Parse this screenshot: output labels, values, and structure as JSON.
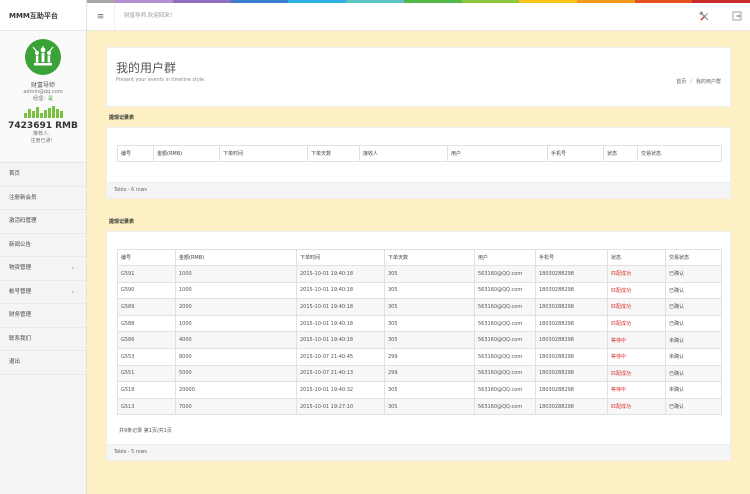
{
  "colors": {
    "rainbow": [
      "#c6c6c6",
      "#a8a8a8",
      "#b48fcf",
      "#8e6fc2",
      "#3d7fcf",
      "#2fb0e4",
      "#5cc3c0",
      "#52b847",
      "#8dc63f",
      "#f8c419",
      "#f39a1e",
      "#e5511e",
      "#c92c2c"
    ],
    "accent_green": "#3aa237",
    "status_red": "#d9302c"
  },
  "sidebar": {
    "brand": "MMM互助平台",
    "profile": {
      "name": "财富导师",
      "email": "admin@qq.com",
      "role_label": "经理：",
      "role_value": "是",
      "balance": "7423691 RMB",
      "referrer_label": "推荐人：",
      "reg_label": "注册已通！",
      "activity": [
        5,
        8,
        6,
        10,
        5,
        7,
        9,
        11,
        8,
        6
      ]
    },
    "menu": [
      {
        "label": "首页",
        "arrow": ""
      },
      {
        "label": "注册新会员",
        "arrow": ""
      },
      {
        "label": "激活码管理",
        "arrow": ""
      },
      {
        "label": "新闻公告",
        "arrow": ""
      },
      {
        "label": "物资管理",
        "arrow": "‹"
      },
      {
        "label": "帐号管理",
        "arrow": "‹"
      },
      {
        "label": "财务管理",
        "arrow": ""
      },
      {
        "label": "联系我们",
        "arrow": ""
      },
      {
        "label": "退出",
        "arrow": ""
      }
    ]
  },
  "topbar": {
    "toggle_icon": "≡",
    "welcome": "财富导师,欢迎回来！"
  },
  "header": {
    "title": "我的用户群",
    "subtitle": "Present your events in timeline style.",
    "breadcrumb_home": "首页",
    "breadcrumb_sep": "/",
    "breadcrumb_current": "我的用户群"
  },
  "section1": {
    "title": "提现记录表",
    "columns": [
      "编号",
      "金额(RMB)",
      "下单时间",
      "下单天数",
      "接收人",
      "用户",
      "手机号",
      "状态",
      "交易状态"
    ],
    "footer": "Table - 6 rows"
  },
  "section2": {
    "title": "提现记录表",
    "columns": [
      "编号",
      "金额(RMB)",
      "下单时间",
      "下单天数",
      "用户",
      "手机号",
      "状态",
      "交易状态"
    ],
    "rows": [
      {
        "id": "G591",
        "amount": "1000",
        "time": "2015-10-01 19:40:18",
        "days": "305",
        "user": "563160@QQ.com",
        "phone": "18030288298",
        "status": "匹配成功",
        "status_red": true,
        "trade": "已确认"
      },
      {
        "id": "G590",
        "amount": "1000",
        "time": "2015-10-01 19:40:18",
        "days": "305",
        "user": "563160@QQ.com",
        "phone": "18030288298",
        "status": "匹配成功",
        "status_red": true,
        "trade": "已确认"
      },
      {
        "id": "G589",
        "amount": "2000",
        "time": "2015-10-01 19:40:18",
        "days": "305",
        "user": "563160@QQ.com",
        "phone": "18030288298",
        "status": "匹配成功",
        "status_red": true,
        "trade": "已确认"
      },
      {
        "id": "G588",
        "amount": "1000",
        "time": "2015-10-01 19:40:18",
        "days": "305",
        "user": "563160@QQ.com",
        "phone": "18030288298",
        "status": "匹配成功",
        "status_red": true,
        "trade": "已确认"
      },
      {
        "id": "G586",
        "amount": "4000",
        "time": "2015-10-01 19:40:18",
        "days": "305",
        "user": "563160@QQ.com",
        "phone": "18030288298",
        "status": "等待中",
        "status_red": true,
        "trade": "未确认"
      },
      {
        "id": "G553",
        "amount": "8000",
        "time": "2015-10-07 21:40:45",
        "days": "299",
        "user": "563160@QQ.com",
        "phone": "18030288298",
        "status": "等待中",
        "status_red": true,
        "trade": "未确认"
      },
      {
        "id": "G551",
        "amount": "5000",
        "time": "2015-10-07 21:40:13",
        "days": "299",
        "user": "563160@QQ.com",
        "phone": "18030288298",
        "status": "匹配成功",
        "status_red": true,
        "trade": "已确认"
      },
      {
        "id": "G518",
        "amount": "20000",
        "time": "2015-10-01 19:40:32",
        "days": "305",
        "user": "563160@QQ.com",
        "phone": "18030288298",
        "status": "等待中",
        "status_red": true,
        "trade": "未确认"
      },
      {
        "id": "G513",
        "amount": "7000",
        "time": "2015-10-01 19:27:10",
        "days": "305",
        "user": "563160@QQ.com",
        "phone": "18030288298",
        "status": "匹配成功",
        "status_red": true,
        "trade": "已确认"
      }
    ],
    "pager": "共9条记录 第1页/共1页",
    "footer": "Table - 5 rows"
  }
}
